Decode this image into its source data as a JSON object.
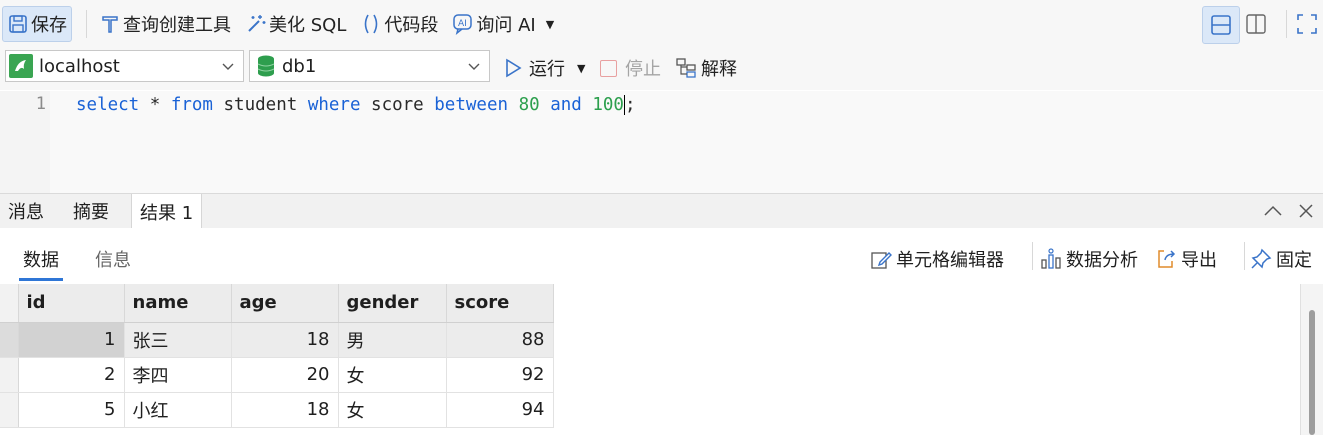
{
  "toolbar": {
    "save": "保存",
    "query_builder": "查询创建工具",
    "beautify": "美化 SQL",
    "snippet": "代码段",
    "ask_ai": "询问 AI"
  },
  "connection": {
    "value": "localhost"
  },
  "database": {
    "value": "db1"
  },
  "actions": {
    "run": "运行",
    "stop": "停止",
    "explain": "解释"
  },
  "editor": {
    "line_number": "1",
    "tokens": {
      "t1": "select",
      "t2": " * ",
      "t3": "from",
      "t4": " student ",
      "t5": "where",
      "t6": " score ",
      "t7": "between",
      "t8": " ",
      "t9": "80",
      "t10": " ",
      "t11": "and",
      "t12": " ",
      "t13": "100",
      "t14": ";"
    }
  },
  "result_tabs": [
    "消息",
    "摘要",
    "结果 1"
  ],
  "sub_tabs": [
    "数据",
    "信息"
  ],
  "sub_actions": {
    "cell_editor": "单元格编辑器",
    "data_analysis": "数据分析",
    "export": "导出",
    "pin": "固定"
  },
  "grid": {
    "columns": [
      "id",
      "name",
      "age",
      "gender",
      "score"
    ],
    "rows": [
      [
        "1",
        "张三",
        "18",
        "男",
        "88"
      ],
      [
        "2",
        "李四",
        "20",
        "女",
        "92"
      ],
      [
        "5",
        "小红",
        "18",
        "女",
        "94"
      ]
    ]
  },
  "colors": {
    "accent": "#2f76d6",
    "keyword": "#1a62d6",
    "number": "#2c9f4d",
    "db_icon": "#2e9e4e"
  }
}
